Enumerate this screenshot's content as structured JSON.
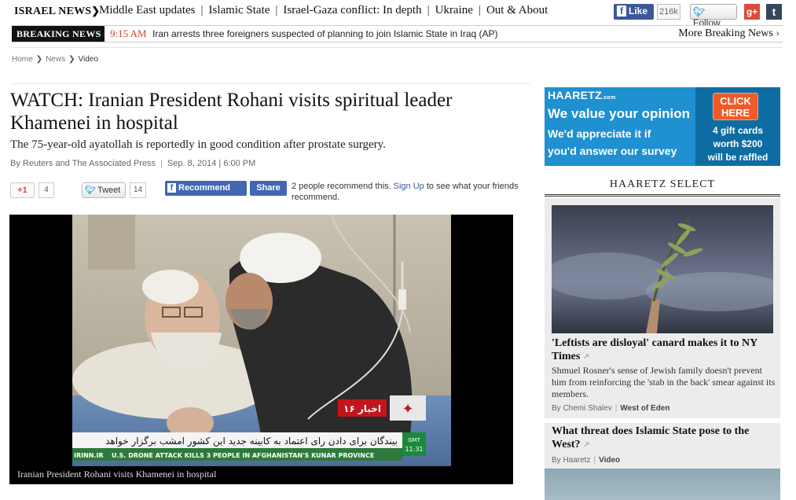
{
  "topnav": {
    "brand": "ISRAEL NEWS",
    "links": [
      "Middle East updates",
      "Islamic State",
      "Israel-Gaza conflict: In depth",
      "Ukraine",
      "Out & About"
    ],
    "fb_like_label": "Like",
    "fb_like_count": "216k",
    "tw_follow_label": "Follow"
  },
  "breaking": {
    "label": "BREAKING NEWS",
    "time": "9:15 AM",
    "headline": "Iran arrests three foreigners suspected of planning to join Islamic State in Iraq (AP)",
    "more_label": "More Breaking News"
  },
  "breadcrumb": [
    "Home",
    "News",
    "Video"
  ],
  "article": {
    "title": "WATCH: Iranian President Rohani visits spiritual leader Khamenei in hospital",
    "subtitle": "The 75-year-old ayatollah is reportedly in good condition after prostate surgery.",
    "byline": "By Reuters and The Associated Press",
    "date": "Sep. 8, 2014 | 6:00 PM"
  },
  "share": {
    "gplus_label": "+1",
    "gplus_count": "4",
    "tweet_label": "Tweet",
    "tweet_count": "14",
    "fb_recommend_label": "Recommend",
    "fb_share_label": "Share",
    "fb_text_before": "2 people recommend this.",
    "fb_signup_label": "Sign Up",
    "fb_text_after": "to see what your friends recommend."
  },
  "video": {
    "caption": "Iranian President Rohani visits Khamenei in hospital",
    "channel_logo_text": "اخبار ۱۶",
    "ticker_farsi": "بیندگان برای دادن رای اعتماد به کابینه جدید این کشور امشب برگزار خواهد",
    "ticker_english": "U.S. DRONE ATTACK KILLS 3 PEOPLE IN AFGHANISTAN'S KUNAR PROVINCE",
    "ticker_source": "IRINN.IR",
    "gmt_label": "GMT",
    "gmt_time": "11:31"
  },
  "ad": {
    "logo": "HAARETZ",
    "logo_suffix": ".com",
    "line1": "We value your opinion",
    "line2": "We'd appreciate it if",
    "line3": "you'd answer our survey",
    "cta_line1": "CLICK",
    "cta_line2": "HERE",
    "right1": "4 gift cards",
    "right2": "worth $200",
    "right3": "will be raffled"
  },
  "select": {
    "heading": "HAARETZ SELECT",
    "cards": [
      {
        "title": "'Leftists are disloyal' canard makes it to NY Times",
        "desc": "Shmuel Rosner's sense of Jewish family doesn't prevent him from reinforcing the 'stab in the back' smear against its members.",
        "author": "By Chemi Shalev",
        "section": "West of Eden"
      },
      {
        "title": "What threat does Islamic State pose to the West?",
        "author": "By Haaretz",
        "section": "Video"
      }
    ]
  },
  "colors": {
    "accent_red": "#d1412b",
    "facebook": "#3b5998",
    "ad_blue": "#1f90d0",
    "ad_orange": "#f05a28"
  }
}
